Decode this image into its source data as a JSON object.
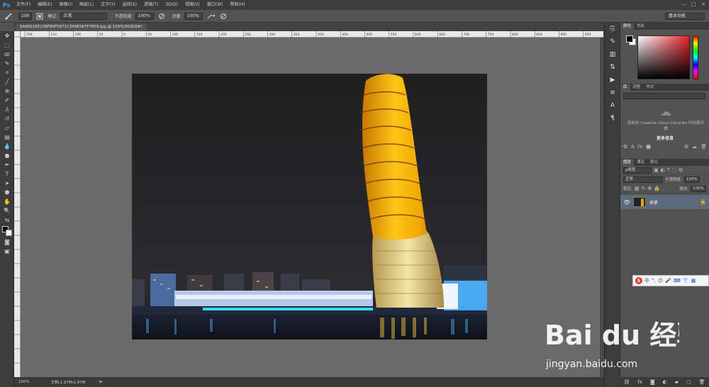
{
  "menubar": {
    "logo": "Ps",
    "items": [
      "文件(F)",
      "编辑(E)",
      "图像(I)",
      "图层(L)",
      "文字(Y)",
      "选择(S)",
      "滤镜(T)",
      "3D(D)",
      "视图(V)",
      "窗口(W)",
      "帮助(H)"
    ],
    "window_controls": [
      "—",
      "□",
      "×"
    ]
  },
  "options": {
    "brush_size": "100",
    "mode_label": "模式:",
    "mode_value": "正常",
    "opacity_label": "不透明度:",
    "opacity_value": "100%",
    "flow_label": "流量:",
    "flow_value": "100%",
    "workspace": "基本功能"
  },
  "document": {
    "tab_title": "8A6601EE238F80F5671C349E587F7859.jpg @ 100%(RGB/8#)",
    "ruler_labels": [
      "200",
      "150",
      "100",
      "50",
      "0",
      "50",
      "100",
      "150",
      "200",
      "250",
      "300",
      "350",
      "400",
      "450",
      "500",
      "550",
      "600",
      "650",
      "700",
      "750",
      "800",
      "850",
      "900",
      "950"
    ]
  },
  "status": {
    "zoom": "100%",
    "doc_info": "文档:1.97M/1.97M"
  },
  "panels": {
    "color_tabs": [
      "颜色",
      "色板"
    ],
    "library_tabs": [
      "库",
      "调整",
      "样式"
    ],
    "library_message": "初始化 Creative Cloud Libraries 时出现问题",
    "library_more": "更多信息",
    "layers_tabs": [
      "图层",
      "通道",
      "路径"
    ],
    "filter_kind": "ρ类型",
    "blend_mode": "正常",
    "opacity_label": "不透明度:",
    "opacity_value": "100%",
    "lock_label": "锁定:",
    "fill_label": "填充:",
    "fill_value": "100%",
    "layer_name": "背景"
  },
  "ime": {
    "logo": "S",
    "items": [
      "中",
      "°,",
      "☺",
      "🎤",
      "⌨",
      "👕",
      "▦"
    ]
  },
  "watermark": {
    "brand": "Bai du 经验",
    "url": "jingyan.baidu.com"
  },
  "colors": {
    "accent_ps": "#3aa0f0",
    "tower_gold": "#e6a400"
  }
}
